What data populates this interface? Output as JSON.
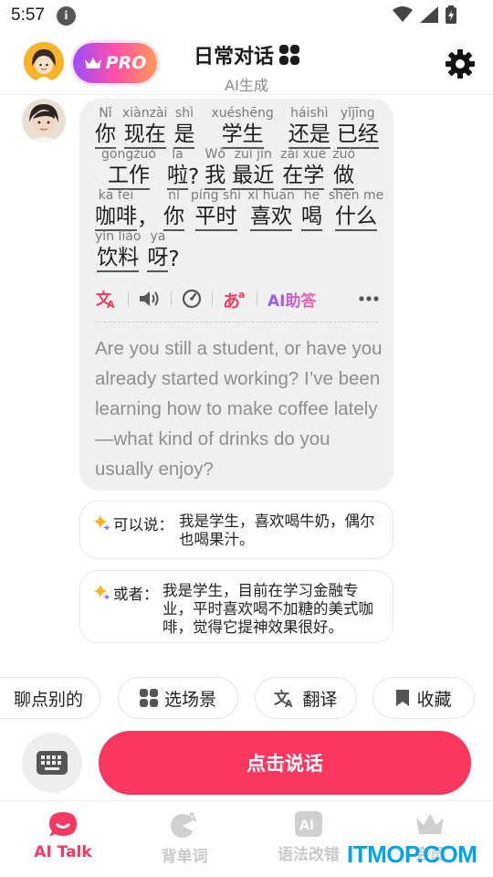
{
  "status_bar": {
    "time": "5:57",
    "info_icon": "i"
  },
  "header": {
    "pro_label": "PRO",
    "title": "日常对话",
    "subtitle": "AI生成"
  },
  "message": {
    "lines": [
      {
        "words": [
          {
            "pinyin": "Nǐ",
            "hanzi": "你"
          },
          {
            "pinyin": "xiànzài",
            "hanzi": "现在"
          },
          {
            "pinyin": "shì",
            "hanzi": "是"
          },
          {
            "pinyin": "xuéshēng",
            "hanzi": "学生"
          },
          {
            "pinyin": "háishì",
            "hanzi": "还是"
          },
          {
            "pinyin": "yǐjīng",
            "hanzi": "已经"
          }
        ],
        "end_punct": ""
      },
      {
        "words": [
          {
            "pinyin": "gōngzuò",
            "hanzi": "工作"
          },
          {
            "pinyin": "la",
            "hanzi": "啦"
          },
          {
            "pinyin": "Wǒ",
            "hanzi": "我"
          },
          {
            "pinyin": "zuì jìn",
            "hanzi": "最近"
          },
          {
            "pinyin": "zài xué",
            "hanzi": "在学"
          },
          {
            "pinyin": "zuò",
            "hanzi": "做"
          }
        ],
        "end_punct": ""
      },
      {
        "words": [
          {
            "pinyin": "kā fēi",
            "hanzi": "咖啡"
          },
          {
            "pinyin": "nǐ",
            "hanzi": "你"
          },
          {
            "pinyin": "píng shí",
            "hanzi": "平时"
          },
          {
            "pinyin": "xǐ huān",
            "hanzi": "喜欢"
          },
          {
            "pinyin": "hē",
            "hanzi": "喝"
          },
          {
            "pinyin": "shén me",
            "hanzi": "什么"
          }
        ],
        "end_punct": ""
      },
      {
        "words": [
          {
            "pinyin": "yǐn liào",
            "hanzi": "饮料"
          },
          {
            "pinyin": "ya",
            "hanzi": "呀"
          }
        ],
        "end_punct": "?"
      }
    ],
    "inline_punct": {
      "after_la": "?",
      "after_kafei": "，"
    },
    "ai_help_label": "AI助答",
    "translation": "Are you still a student, or have you already started working? I’ve been learning how to make coffee lately—what kind of drinks do you usually enjoy?"
  },
  "suggestions": [
    {
      "label": "可以说：",
      "text": "我是学生，喜欢喝牛奶，偶尔也喝果汁。"
    },
    {
      "label": "或者：",
      "text": "我是学生，目前在学习金融专业，平时喜欢喝不加糖的美式咖啡，觉得它提神效果很好。"
    }
  ],
  "chips": {
    "other_topic": "聊点别的",
    "choose_scene": "选场景",
    "translate": "翻译",
    "favorite": "收藏"
  },
  "speak_button": "点击说话",
  "nav": {
    "ai_talk": "AI Talk",
    "vocab": "背单词",
    "grammar": "语法改错",
    "vip": "会员"
  },
  "watermark": "ITMOP.COM",
  "colors": {
    "accent": "#f8385f",
    "nav_active": "#f53a62",
    "watermark": "#00a2e8"
  }
}
